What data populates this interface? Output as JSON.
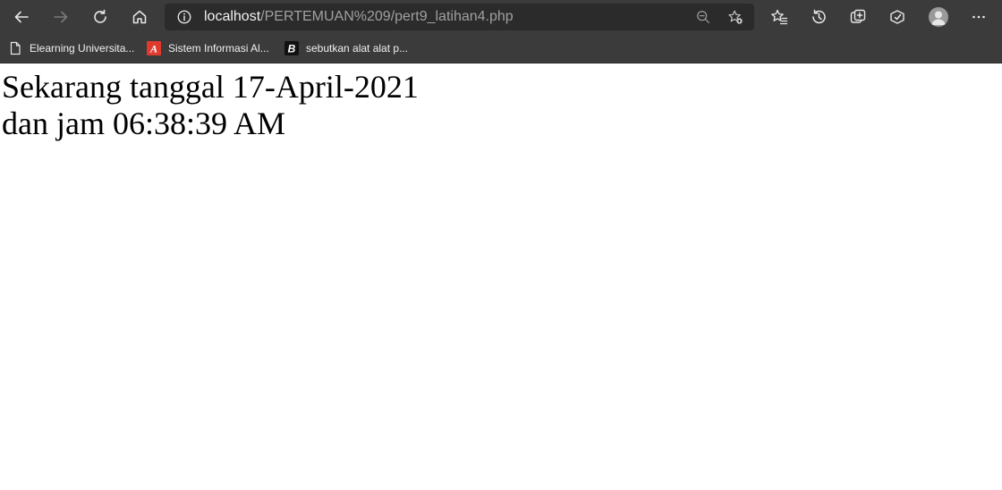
{
  "browser": {
    "address_bar": {
      "host": "localhost",
      "path": "/PERTEMUAN%209/pert9_latihan4.php"
    },
    "nav_buttons": [
      "back-icon",
      "forward-icon",
      "refresh-icon",
      "home-icon"
    ],
    "toolbar_icons": [
      "favorites-icon",
      "history-icon",
      "collections-icon",
      "extensions-icon",
      "profile-avatar",
      "more-icon"
    ]
  },
  "bookmarks": [
    {
      "label": "Elearning Universita...",
      "icon": "page-icon"
    },
    {
      "label": "Sistem Informasi Al...",
      "icon": "a-logo-icon"
    },
    {
      "label": "sebutkan alat alat p...",
      "icon": "b-logo-icon"
    }
  ],
  "page": {
    "line1": "Sekarang tanggal 17-April-2021",
    "line2": "dan jam 06:38:39 AM"
  },
  "colors": {
    "toolbar_bg": "#3b3b3b",
    "address_bg": "#2b2b2b",
    "bookmark_a_icon": "#e03a2f",
    "page_bg": "#ffffff"
  }
}
